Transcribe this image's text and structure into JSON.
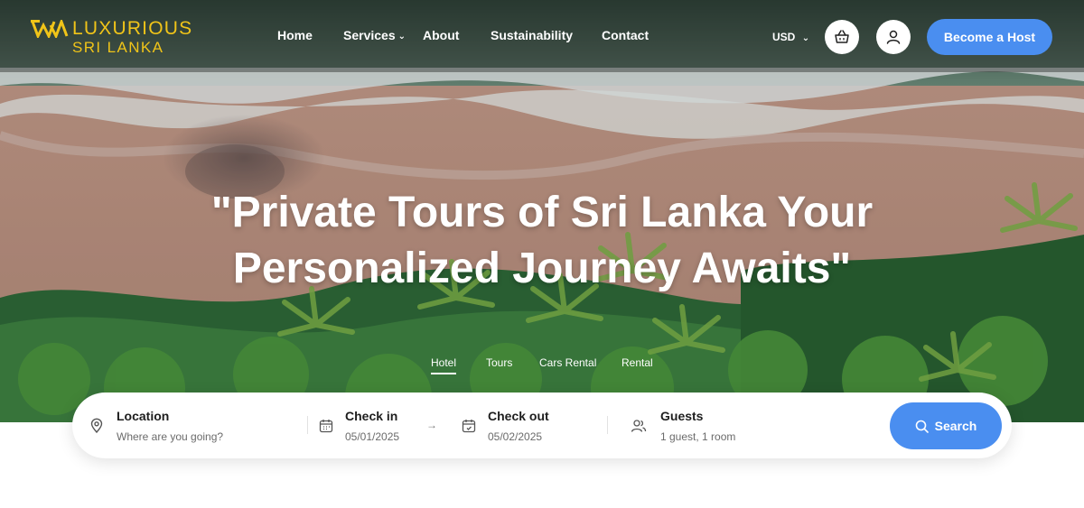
{
  "brand": {
    "line1": "LUXURIOUS",
    "line2": "SRI LANKA",
    "color": "#f0c419"
  },
  "nav": {
    "links": [
      {
        "label": "Home"
      },
      {
        "label": "Services",
        "has_dropdown": true
      },
      {
        "label": "About"
      },
      {
        "label": "Sustainability"
      },
      {
        "label": "Contact"
      }
    ],
    "currency": "USD",
    "cart_icon": "basket-icon",
    "account_icon": "user-icon",
    "host_button": "Become a Host"
  },
  "hero": {
    "headline_line1": "\"Private Tours of Sri Lanka Your",
    "headline_line2": "Personalized Journey Awaits\"",
    "background": "aerial beach with palm trees"
  },
  "tabs": [
    {
      "label": "Hotel",
      "active": true
    },
    {
      "label": "Tours",
      "active": false
    },
    {
      "label": "Cars Rental",
      "active": false
    },
    {
      "label": "Rental",
      "active": false
    }
  ],
  "search": {
    "location": {
      "label": "Location",
      "placeholder": "Where are you going?",
      "icon": "map-pin-icon"
    },
    "check_in": {
      "label": "Check in",
      "value": "05/01/2025",
      "icon": "calendar-icon"
    },
    "check_out": {
      "label": "Check out",
      "value": "05/02/2025",
      "icon": "calendar-icon"
    },
    "guests": {
      "label": "Guests",
      "value": "1 guest, 1 room",
      "icon": "users-icon"
    },
    "button": "Search",
    "accent": "#4a8ef0"
  }
}
